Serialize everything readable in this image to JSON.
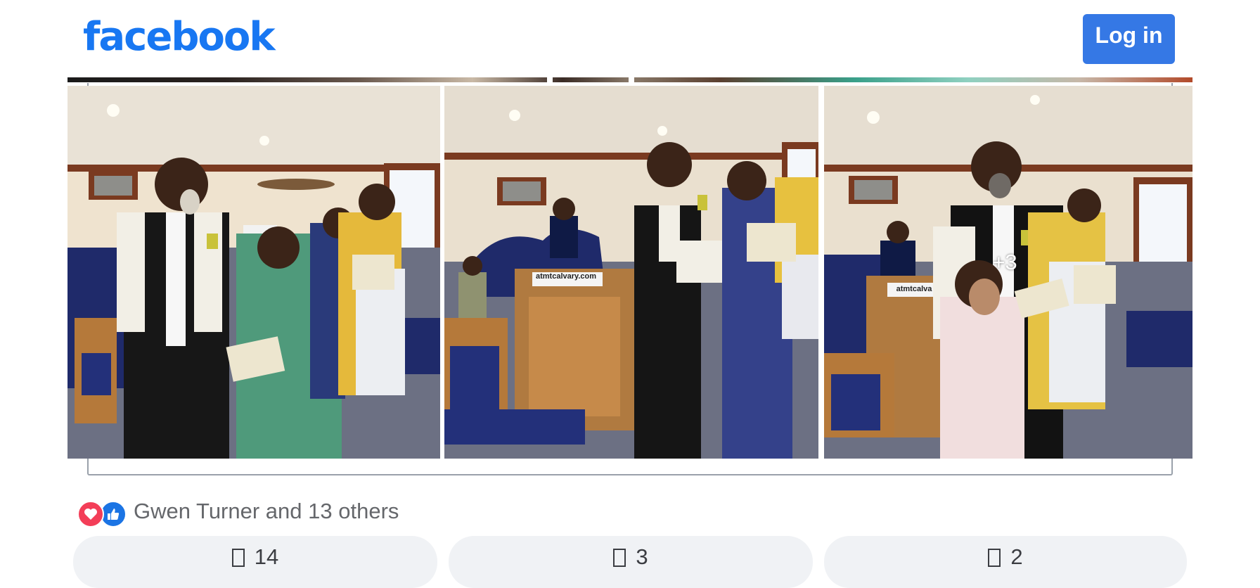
{
  "header": {
    "logo_text": "facebook",
    "login_label": "Log in"
  },
  "photos": {
    "more_count": "+3",
    "sign_text": "atmtcalvary.com",
    "sign_text_short": "atmtcalva"
  },
  "reactions": {
    "summary": "Gwen Turner and 13 others",
    "icons": [
      "love-icon",
      "like-icon"
    ]
  },
  "actions": [
    {
      "icon": "like-icon",
      "count": "14"
    },
    {
      "icon": "comment-icon",
      "count": "3"
    },
    {
      "icon": "share-icon",
      "count": "2"
    }
  ],
  "colors": {
    "brand": "#1877f2",
    "login_button": "#3578e5",
    "love": "#f33e58",
    "like": "#1b74e4",
    "action_bg": "#f0f2f5"
  }
}
